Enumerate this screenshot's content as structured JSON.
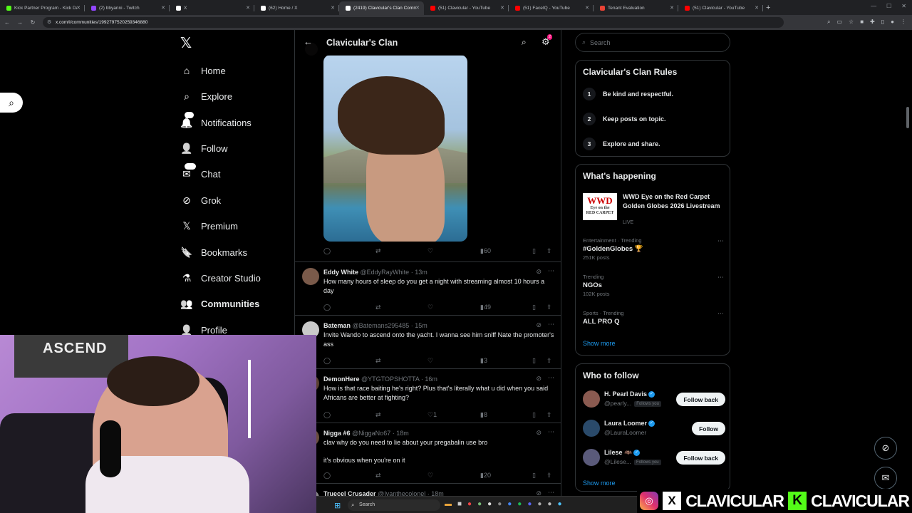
{
  "browser": {
    "tabs": [
      {
        "title": "Kick Partner Program - Kick Dash",
        "color": "#53fc18"
      },
      {
        "title": "(2) bbyanni - Twitch",
        "color": "#9146ff"
      },
      {
        "title": "X",
        "color": "#ffffff"
      },
      {
        "title": "(62) Home / X",
        "color": "#ffffff"
      },
      {
        "title": "(2419) Clavicular's Clan Community",
        "color": "#ffffff"
      },
      {
        "title": "(51) Clavicular - YouTube",
        "color": "#ff0000"
      },
      {
        "title": "(51) FaceIQ - YouTube",
        "color": "#ff0000"
      },
      {
        "title": "Tenant Evaluation",
        "color": "#ea4335"
      },
      {
        "title": "(51) Clavicular - YouTube",
        "color": "#ff0000"
      }
    ],
    "url": "x.com/i/communities/1992797520259346880"
  },
  "sidebar": {
    "items": [
      {
        "label": "Home",
        "icon": "home-icon"
      },
      {
        "label": "Explore",
        "icon": "search-icon"
      },
      {
        "label": "Notifications",
        "icon": "bell-icon",
        "badge": "18"
      },
      {
        "label": "Follow",
        "icon": "add-user-icon"
      },
      {
        "label": "Chat",
        "icon": "mail-icon",
        "badge": "20+"
      },
      {
        "label": "Grok",
        "icon": "grok-icon"
      },
      {
        "label": "Premium",
        "icon": "x-icon"
      },
      {
        "label": "Bookmarks",
        "icon": "bookmark-icon"
      },
      {
        "label": "Creator Studio",
        "icon": "flask-icon"
      },
      {
        "label": "Communities",
        "icon": "people-icon"
      },
      {
        "label": "Profile",
        "icon": "person-icon"
      }
    ]
  },
  "header": {
    "title": "Clavicular's Clan",
    "gear_badge": "2"
  },
  "first_post": {
    "views": "60"
  },
  "tweets": [
    {
      "name": "Eddy White",
      "handle": "@EddyRayWhite",
      "time": "13m",
      "text": "How many hours of sleep do you get a night with streaming almost 10 hours a day",
      "likes": "",
      "views": "49",
      "avatar": "#7a5a4a"
    },
    {
      "name": "Bateman",
      "handle": "@Batemans295485",
      "time": "15m",
      "text": "Invite Wando to ascend onto the yacht. I wanna see him sniff Nate the promoter's ass",
      "likes": "",
      "views": "3",
      "avatar": "#c9c9c9"
    },
    {
      "name": "DemonHere",
      "handle": "@YTGTOPSHOTTA",
      "time": "16m",
      "text": "How is that race baiting he's right? Plus that's literally what u did when you said Africans are better at fighting?",
      "likes": "1",
      "views": "8",
      "avatar": "#5a4030"
    },
    {
      "name": "Nigga #6",
      "handle": "@NiggaNo67",
      "time": "18m",
      "text": "clav why do you need to lie about your pregabalin use bro\n\nit's obvious when you're on it",
      "likes": "",
      "views": "20",
      "avatar": "#6a4e3e"
    },
    {
      "name": "Truecel Crusader",
      "handle": "@Ivanthecolonel",
      "time": "18m",
      "text": "",
      "likes": "",
      "views": "",
      "avatar": "#888888"
    }
  ],
  "right": {
    "search_placeholder": "Search",
    "rules_title": "Clavicular's Clan Rules",
    "rules": [
      {
        "num": "1",
        "text": "Be kind and respectful."
      },
      {
        "num": "2",
        "text": "Keep posts on topic."
      },
      {
        "num": "3",
        "text": "Explore and share."
      }
    ],
    "happening_title": "What's happening",
    "featured": {
      "logo_top": "WWD",
      "logo_mid": "Eye on the",
      "logo_bot": "RED CARPET",
      "title": "WWD Eye on the Red Carpet Golden Globes 2026 Livestream",
      "status": "LIVE"
    },
    "trends": [
      {
        "meta": "Entertainment · Trending",
        "name": "#GoldenGlobes 🏆",
        "posts": "251K posts"
      },
      {
        "meta": "Trending",
        "name": "NGOs",
        "posts": "102K posts"
      },
      {
        "meta": "Sports · Trending",
        "name": "ALL PRO Q",
        "posts": ""
      }
    ],
    "show_more": "Show more",
    "who_title": "Who to follow",
    "who": [
      {
        "name": "H. Pearl Davis",
        "handle": "@pearly...",
        "follows_you": "Follows you",
        "button": "Follow back",
        "avatar": "#8a5a50"
      },
      {
        "name": "Laura Loomer",
        "handle": "@LauraLoomer",
        "follows_you": "",
        "button": "Follow",
        "avatar": "#2a4a6a"
      },
      {
        "name": "Lilese 🦇",
        "handle": "@Lilese...",
        "follows_you": "Follows you",
        "button": "Follow back",
        "avatar": "#5a5a7a"
      }
    ],
    "show_more_2": "Show more"
  },
  "webcam": {
    "banner_text": "ASCEND"
  },
  "taskbar": {
    "search": "Search"
  },
  "branding": {
    "left": "CLAVICULAR",
    "right": "CLAVICULAR"
  }
}
